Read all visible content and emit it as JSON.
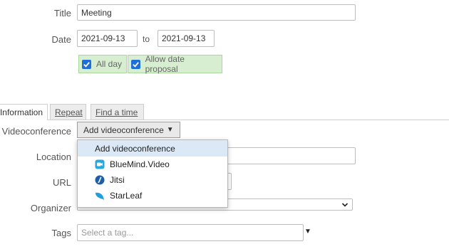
{
  "form": {
    "title_label": "Title",
    "title_value": "Meeting",
    "date_label": "Date",
    "date_start": "2021-09-13",
    "to_label": "to",
    "date_end": "2021-09-13",
    "all_day_label": "All day",
    "all_day_checked": true,
    "allow_proposal_label": "Allow date proposal",
    "allow_proposal_checked": true
  },
  "tabs": [
    {
      "label": "Information",
      "active": true
    },
    {
      "label": "Repeat",
      "active": false
    },
    {
      "label": "Find a time",
      "active": false
    }
  ],
  "details": {
    "videoconference_label": "Videoconference",
    "videoconference_button": "Add videoconference",
    "location_label": "Location",
    "url_label": "URL",
    "organizer_label": "Organizer",
    "tags_label": "Tags",
    "tags_placeholder": "Select a tag..."
  },
  "videoconference_menu": {
    "items": [
      {
        "label": "Add videoconference",
        "icon": "none",
        "highlighted": true
      },
      {
        "label": "BlueMind.Video",
        "icon": "bluemind-video-icon",
        "color": "#29a8e0"
      },
      {
        "label": "Jitsi",
        "icon": "jitsi-icon",
        "color": "#1d5fa8"
      },
      {
        "label": "StarLeaf",
        "icon": "starleaf-icon",
        "color": "#1ea0e0"
      }
    ]
  },
  "colors": {
    "checkbox_bg": "#1f6fd6",
    "checkbox_wrap_bg": "#d7efd0",
    "menu_highlight": "#dbe8f6"
  }
}
